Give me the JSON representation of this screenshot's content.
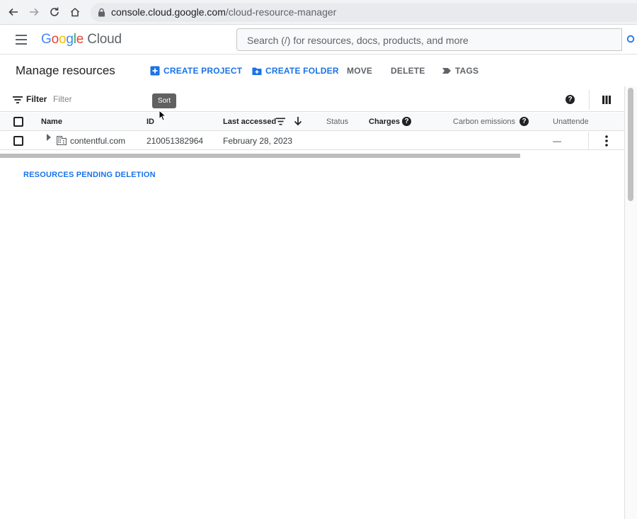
{
  "browser": {
    "url_host": "console.cloud.google.com",
    "url_path": "/cloud-resource-manager"
  },
  "header": {
    "logo_google": "Google",
    "logo_cloud": "Cloud",
    "search_placeholder": "Search (/) for resources, docs, products, and more"
  },
  "toolbar": {
    "title": "Manage resources",
    "create_project": "CREATE PROJECT",
    "create_folder": "CREATE FOLDER",
    "move": "MOVE",
    "delete": "DELETE",
    "tags": "TAGS"
  },
  "filter": {
    "label": "Filter",
    "placeholder": "Filter"
  },
  "tooltip": "Sort",
  "table": {
    "columns": {
      "name": "Name",
      "id": "ID",
      "last_accessed": "Last accessed",
      "status": "Status",
      "charges": "Charges",
      "carbon": "Carbon emissions",
      "unattended": "Unattende"
    },
    "rows": [
      {
        "name": "contentful.com",
        "id": "210051382964",
        "last_accessed": "February 28, 2023",
        "unattended": "—"
      }
    ]
  },
  "pending_deletion": "RESOURCES PENDING DELETION",
  "colors": {
    "accent": "#1a73e8",
    "google_blue": "#4285f4",
    "google_red": "#ea4335",
    "google_yellow": "#fbbc04",
    "google_green": "#34a853"
  }
}
